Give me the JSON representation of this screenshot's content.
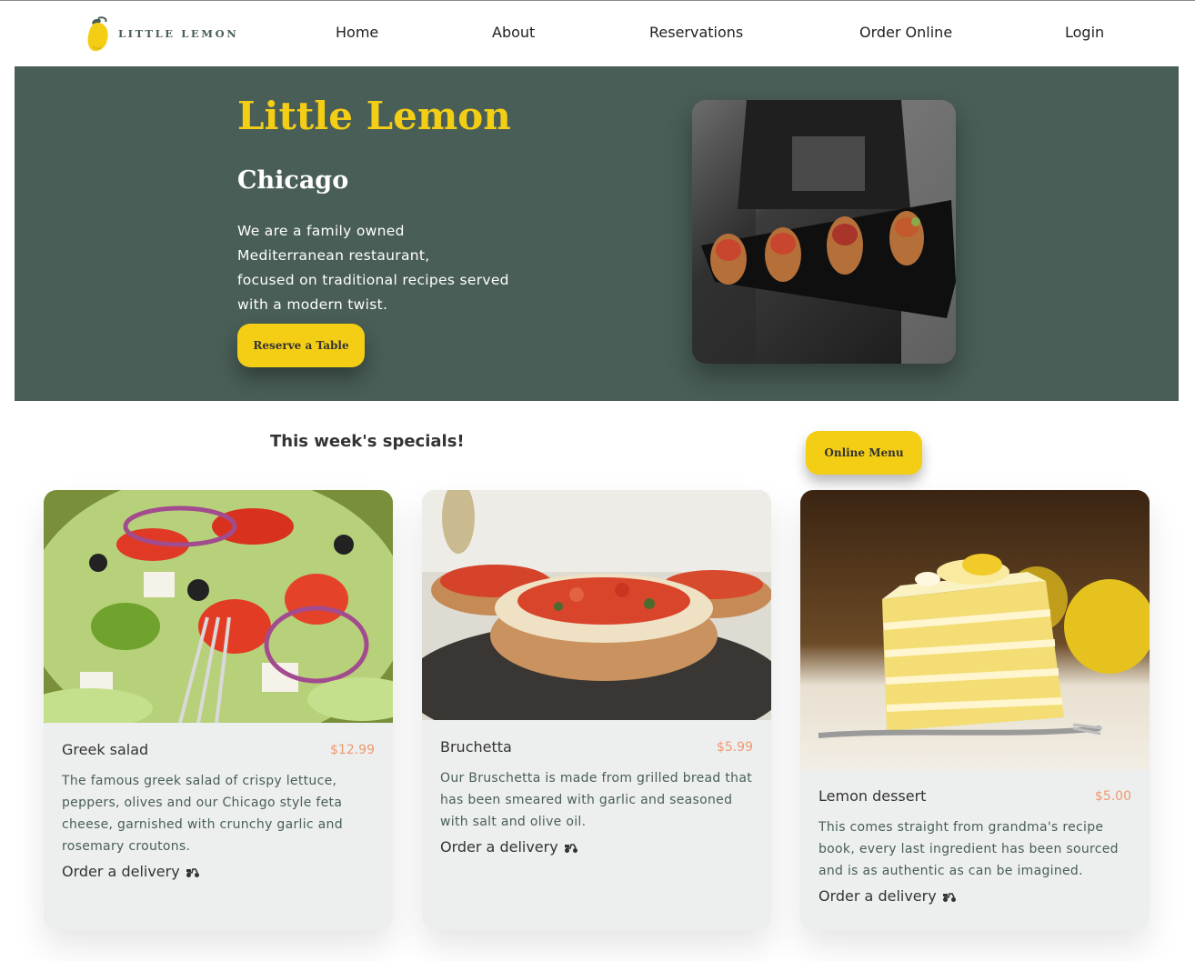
{
  "nav": {
    "logo_text": "LITTLE LEMON",
    "links": [
      "Home",
      "About",
      "Reservations",
      "Order Online",
      "Login"
    ]
  },
  "hero": {
    "title": "Little Lemon",
    "subtitle": "Chicago",
    "description_lines": [
      "We are a family owned",
      "Mediterranean restaurant,",
      "focused on traditional recipes served",
      "with a modern twist."
    ],
    "reserve_label": "Reserve a Table",
    "image_icon": "chef-bruschetta-plate-photo"
  },
  "specials": {
    "title": "This week's specials!",
    "menu_button_label": "Online Menu",
    "cards": [
      {
        "name": "Greek salad",
        "price": "$12.99",
        "description_lines": [
          "The famous greek salad of crispy lettuce,",
          "peppers, olives and our Chicago style feta",
          "cheese, garnished with crunchy garlic and",
          "rosemary croutons."
        ],
        "delivery_label": "Order a delivery",
        "image_icon": "greek-salad-photo"
      },
      {
        "name": "Bruchetta",
        "price": "$5.99",
        "description_lines": [
          "Our Bruschetta is made from grilled bread that",
          "has been smeared with garlic and seasoned",
          "with salt and olive oil."
        ],
        "delivery_label": "Order a delivery",
        "image_icon": "bruschetta-photo"
      },
      {
        "name": "Lemon dessert",
        "price": "$5.00",
        "description_lines": [
          "This comes straight from grandma's recipe",
          "book, every last ingredient has been sourced",
          "and is as authentic as can be imagined."
        ],
        "delivery_label": "Order a delivery",
        "image_icon": "lemon-cake-photo"
      }
    ]
  },
  "colors": {
    "primary_green": "#495e57",
    "primary_yellow": "#f4ce14",
    "price_orange": "#ee9972",
    "card_bg": "#edefee"
  }
}
